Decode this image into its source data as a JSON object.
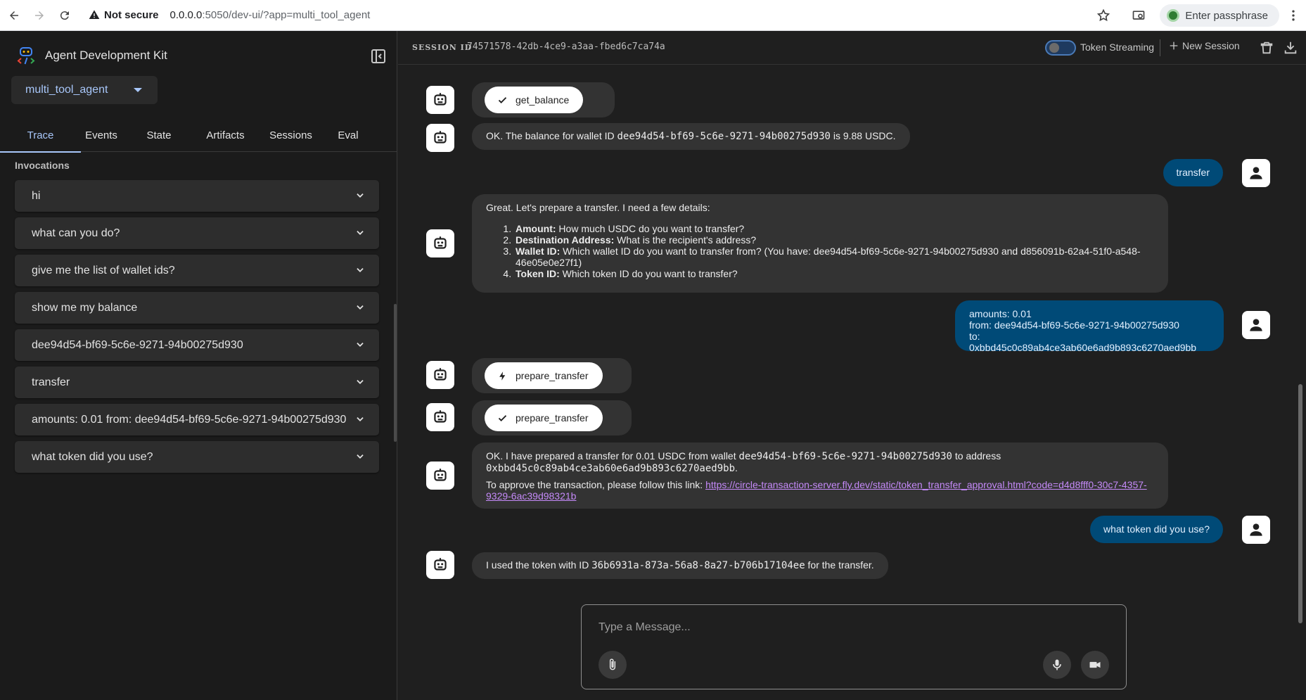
{
  "browser": {
    "security_label": "Not secure",
    "url_host": "0.0.0.0",
    "url_rest": ":5050/dev-ui/?app=multi_tool_agent",
    "passphrase_label": "Enter passphrase"
  },
  "sidebar": {
    "brand_title": "Agent Development Kit",
    "app_selected": "multi_tool_agent",
    "tabs": [
      {
        "label": "Trace",
        "active": true
      },
      {
        "label": "Events"
      },
      {
        "label": "State"
      },
      {
        "label": "Artifacts"
      },
      {
        "label": "Sessions"
      },
      {
        "label": "Eval"
      }
    ],
    "invocations_title": "Invocations",
    "invocations": [
      "hi",
      "what can you do?",
      "give me the list of wallet ids?",
      "show me my balance",
      "dee94d54-bf69-5c6e-9271-94b00275d930",
      "transfer",
      "amounts: 0.01 from: dee94d54-bf69-5c6e-9271-94b00275d930",
      "what token did you use?"
    ]
  },
  "header": {
    "session_label": "SESSION ID",
    "session_id": "74571578-42db-4ce9-a3aa-fbed6c7ca74a",
    "streaming_label": "Token Streaming",
    "new_session_label": "New Session"
  },
  "chat": {
    "tool_get_balance": "get_balance",
    "msg_balance_pre": "OK. The balance for wallet ID ",
    "msg_balance_id": "dee94d54-bf69-5c6e-9271-94b00275d930",
    "msg_balance_post": " is 9.88 USDC.",
    "user_transfer": "transfer",
    "msg_details_intro": "Great. Let's prepare a transfer. I need a few details:",
    "details": [
      {
        "key": "Amount:",
        "text": " How much USDC do you want to transfer?"
      },
      {
        "key": "Destination Address:",
        "text": " What is the recipient's address?"
      },
      {
        "key": "Wallet ID:",
        "text": " Which wallet ID do you want to transfer from? (You have: dee94d54-bf69-5c6e-9271-94b00275d930 and d856091b-62a4-51f0-a548-46e05e0e27f1)"
      },
      {
        "key": "Token ID:",
        "text": " Which token ID do you want to transfer?"
      }
    ],
    "user_amounts_lines": [
      "amounts: 0.01",
      "from: dee94d54-bf69-5c6e-9271-94b00275d930",
      "to: 0xbbd45c0c89ab4ce3ab60e6ad9b893c6270aed9bb"
    ],
    "tool_prepare_call": "prepare_transfer",
    "tool_prepare_result": "prepare_transfer",
    "msg_prepared_pre": "OK. I have prepared a transfer for 0.01 USDC from wallet ",
    "msg_prepared_wallet": "dee94d54-bf69-5c6e-9271-94b00275d930",
    "msg_prepared_mid": " to address",
    "msg_prepared_addr": "0xbbd45c0c89ab4ce3ab60e6ad9b893c6270aed9bb",
    "msg_prepared_dot": ".",
    "msg_approve_pre": "To approve the transaction, please follow this link: ",
    "msg_approve_link": "https://circle-transaction-server.fly.dev/static/token_transfer_approval.html?code=d4d8fff0-30c7-4357-9329-6ac39d98321b",
    "user_token_question": "what token did you use?",
    "msg_token_pre": "I used the token with ID ",
    "msg_token_id": "36b6931a-873a-56a8-8a27-b706b17104ee",
    "msg_token_post": " for the transfer."
  },
  "input": {
    "placeholder": "Type a Message..."
  }
}
